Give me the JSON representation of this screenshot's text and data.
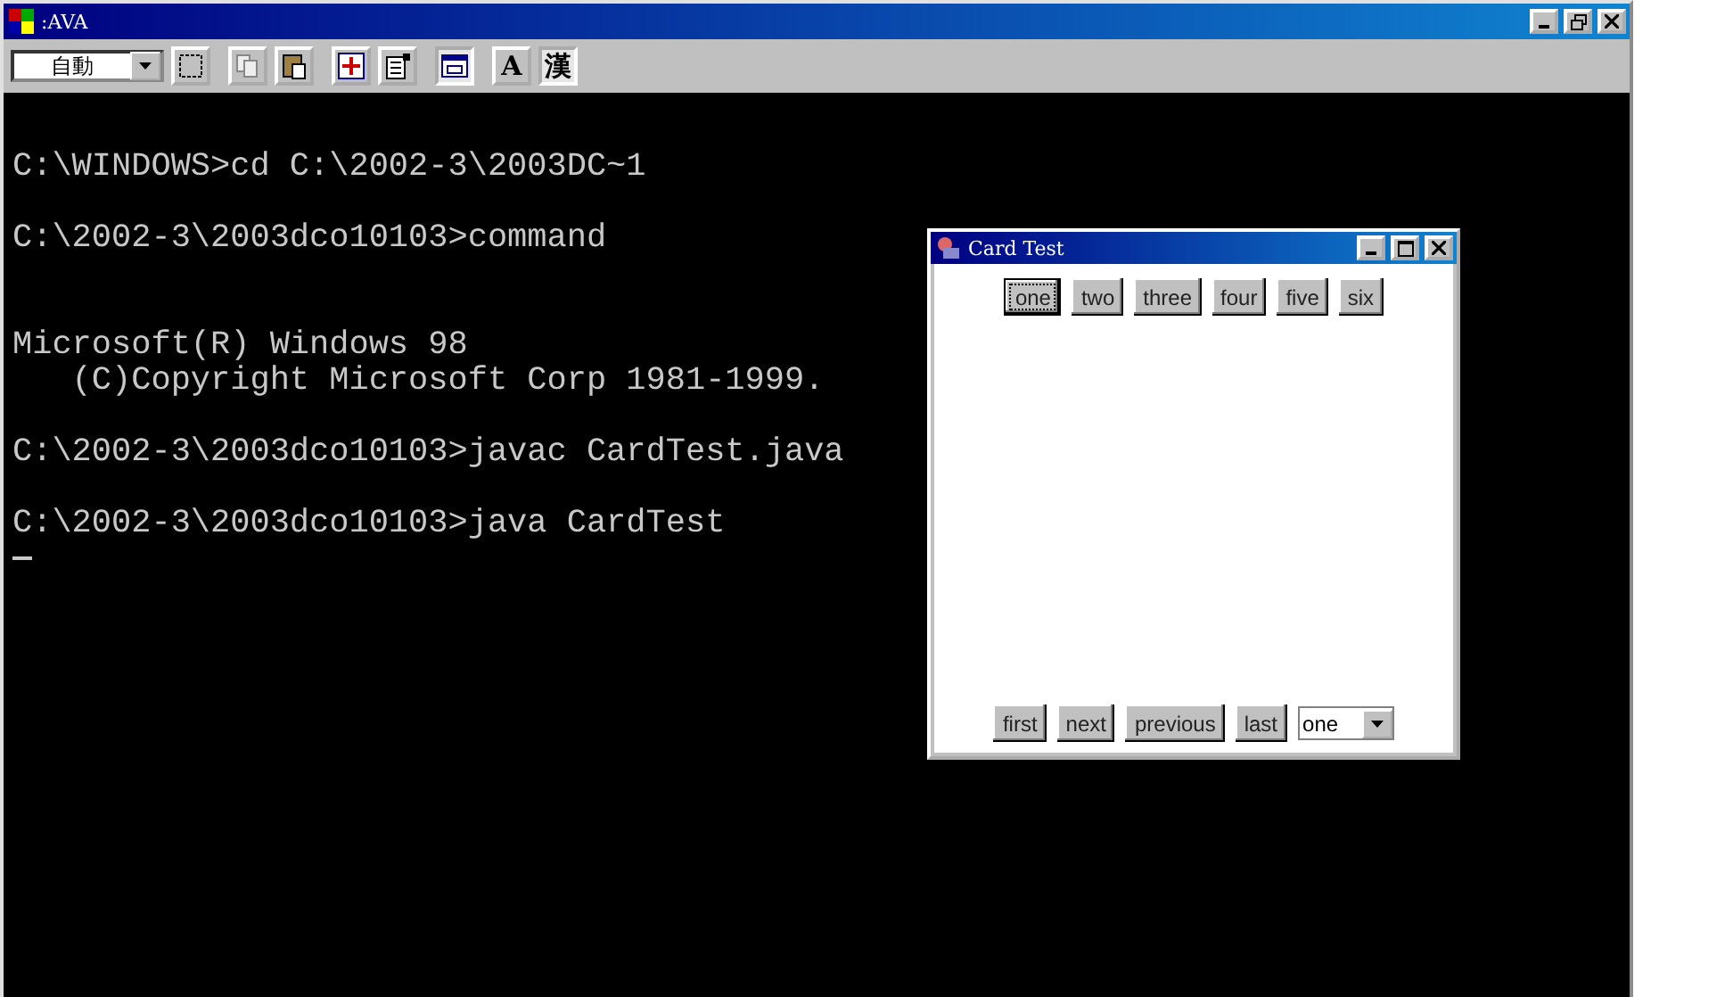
{
  "window": {
    "title": ":AVA"
  },
  "toolbar": {
    "font_size_select": "自動",
    "buttons": [
      {
        "kind": "mark",
        "pressed": false
      },
      {
        "kind": "copy",
        "pressed": false
      },
      {
        "kind": "paste",
        "pressed": false
      },
      {
        "kind": "fullscreen",
        "pressed": false
      },
      {
        "kind": "properties",
        "pressed": false
      },
      {
        "kind": "background",
        "pressed": true
      },
      {
        "kind": "font",
        "label": "A",
        "pressed": false
      },
      {
        "kind": "ime",
        "label": "漢",
        "pressed": true
      }
    ]
  },
  "console": {
    "lines": [
      {
        "kind": "blank"
      },
      {
        "kind": "text",
        "text": "C:\\WINDOWS>cd C:\\2002-3\\2003DC~1"
      },
      {
        "kind": "blank"
      },
      {
        "kind": "text",
        "text": "C:\\2002-3\\2003dco10103>command"
      },
      {
        "kind": "blank"
      },
      {
        "kind": "blank"
      },
      {
        "kind": "text",
        "text": "Microsoft(R) Windows 98"
      },
      {
        "kind": "text",
        "text": "   (C)Copyright Microsoft Corp 1981-1999."
      },
      {
        "kind": "blank"
      },
      {
        "kind": "text",
        "text": "C:\\2002-3\\2003dco10103>javac CardTest.java"
      },
      {
        "kind": "blank"
      },
      {
        "kind": "text",
        "text": "C:\\2002-3\\2003dco10103>java CardTest"
      }
    ],
    "cursor": true
  },
  "card_window": {
    "title": "Card Test",
    "top_buttons": [
      {
        "label": "one",
        "focused": true
      },
      {
        "label": "two",
        "focused": false
      },
      {
        "label": "three",
        "focused": false
      },
      {
        "label": "four",
        "focused": false
      },
      {
        "label": "five",
        "focused": false
      },
      {
        "label": "six",
        "focused": false
      }
    ],
    "bottom_buttons": [
      "first",
      "next",
      "previous",
      "last"
    ],
    "choice": "one"
  }
}
